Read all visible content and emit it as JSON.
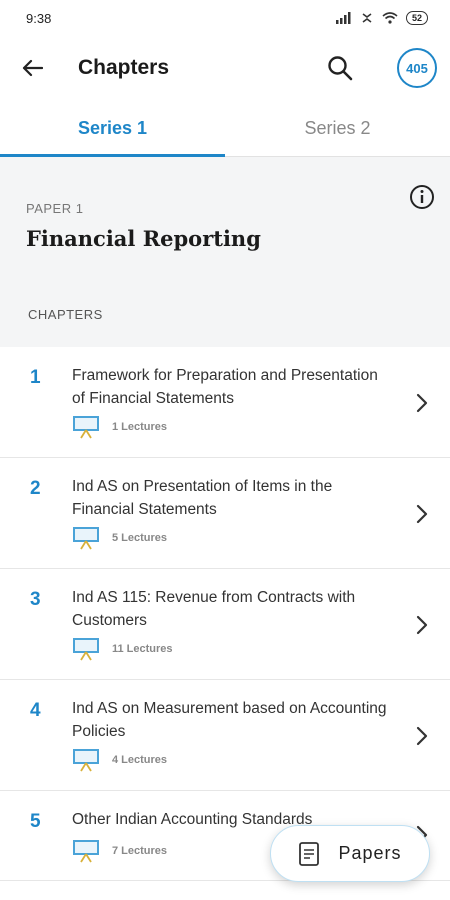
{
  "status_bar": {
    "time": "9:38",
    "battery": "52"
  },
  "app_bar": {
    "title": "Chapters",
    "badge_count": "405"
  },
  "tabs": [
    {
      "label": "Series 1",
      "active": true
    },
    {
      "label": "Series 2",
      "active": false
    }
  ],
  "paper": {
    "label": "PAPER 1",
    "title": "Financial Reporting"
  },
  "chapters_heading": "CHAPTERS",
  "chapters": [
    {
      "number": "1",
      "title": "Framework for Preparation and Presentation of Financial Statements",
      "lectures": "1  Lectures"
    },
    {
      "number": "2",
      "title": "Ind AS on Presentation of Items in the Financial Statements",
      "lectures": "5  Lectures"
    },
    {
      "number": "3",
      "title": "Ind AS 115: Revenue from Contracts with Customers",
      "lectures": "11  Lectures"
    },
    {
      "number": "4",
      "title": "Ind AS on Measurement based on Accounting Policies",
      "lectures": "4  Lectures"
    },
    {
      "number": "5",
      "title": "Other Indian Accounting Standards",
      "lectures": "7  Lectures"
    }
  ],
  "fab": {
    "label": "Papers"
  },
  "colors": {
    "accent": "#1e86c8",
    "section_bg": "#f4f5f6",
    "lecture_icon": "#4aa3d8",
    "lecture_stand": "#d8b13a"
  }
}
